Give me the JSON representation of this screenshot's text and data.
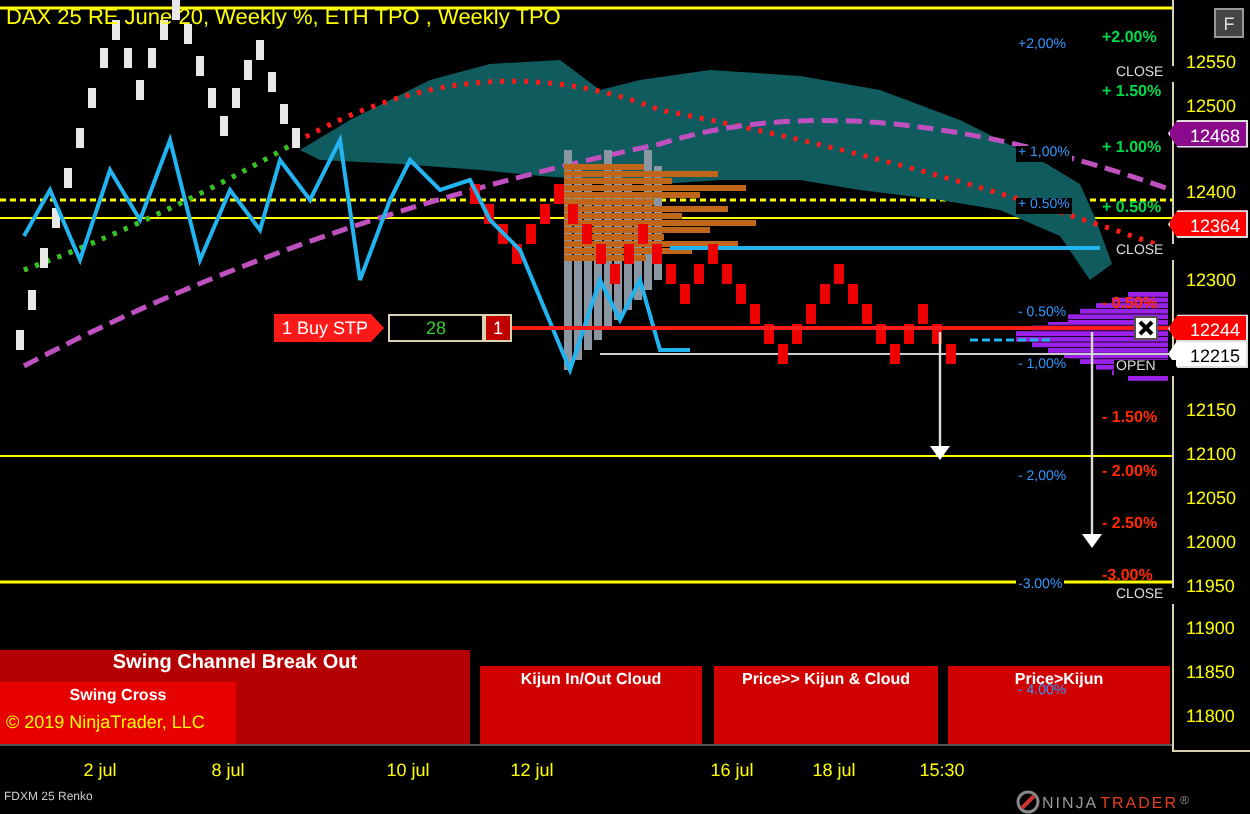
{
  "title": "DAX 25 RE June 20, Weekly %, ETH TPO , Weekly TPO",
  "options_button": "F",
  "price_axis": {
    "ticks": [
      "12550",
      "12500",
      "12400",
      "12300",
      "12150",
      "12100",
      "12050",
      "12000",
      "11950",
      "11900",
      "11850",
      "11800"
    ]
  },
  "price_markers": [
    {
      "label": "12468",
      "color": "#8b0a8b"
    },
    {
      "label": "12364",
      "color": "#ff0000"
    },
    {
      "label": "12244",
      "color": "#ff0000"
    },
    {
      "label": "12215",
      "color": "#ffffff"
    }
  ],
  "weekly_percent_labels": [
    "+2,00%",
    "+ 1,00%",
    "+ 0.50%",
    "- 0.50%",
    "- 1,00%",
    "- 2,00%",
    "-3.00%",
    "- 4.00%"
  ],
  "eth_percent_labels": [
    {
      "text": "+2.00%",
      "color": "#00d84a"
    },
    {
      "text": "+ 1.50%",
      "color": "#00d84a"
    },
    {
      "text": "+ 1.00%",
      "color": "#00d84a"
    },
    {
      "text": "+ 0.50%",
      "color": "#00d84a"
    },
    {
      "text": "- 0.50%",
      "color": "#ff2a00"
    },
    {
      "text": "- 1.50%",
      "color": "#ff2a00"
    },
    {
      "text": "- 2.00%",
      "color": "#ff2a00"
    },
    {
      "text": "- 2.50%",
      "color": "#ff2a00"
    },
    {
      "text": "-3.00%",
      "color": "#ff2a00"
    }
  ],
  "session_labels": [
    "CLOSE",
    "CLOSE",
    "OPEN",
    "CLOSE"
  ],
  "order": {
    "label": "1 Buy STP",
    "quantity": "28",
    "count": "1"
  },
  "signal_panels": [
    {
      "title": "Swing Channel Break Out"
    },
    {
      "title": "Swing Cross"
    },
    {
      "title": "Kijun In/Out Cloud"
    },
    {
      "title": "Price>> Kijun & Cloud"
    },
    {
      "title": "Price>Kijun"
    }
  ],
  "copyright": "© 2019 NinjaTrader, LLC",
  "time_axis": [
    "2 jul",
    "8 jul",
    "10 jul",
    "12 jul",
    "16 jul",
    "18 jul",
    "15:30"
  ],
  "instrument": "FDXM 25 Renko",
  "logo": {
    "part_1": "NINJA",
    "part_2": "TRADER",
    "mark": "®"
  }
}
